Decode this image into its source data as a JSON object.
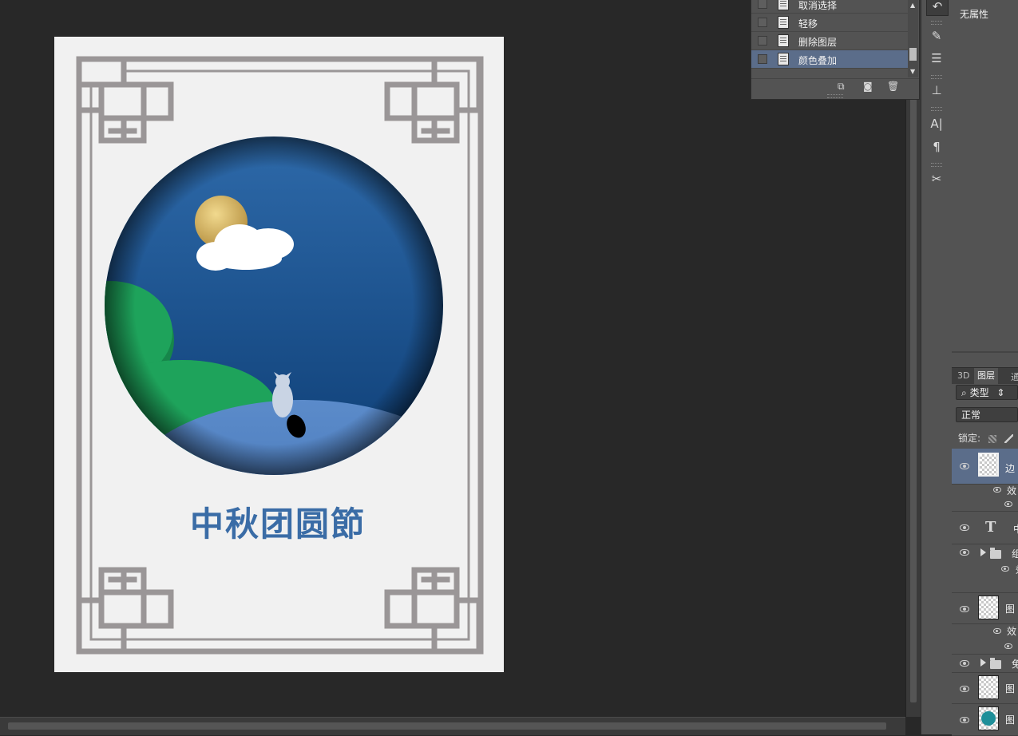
{
  "history": {
    "items": [
      {
        "label": "取消选择",
        "active": false
      },
      {
        "label": "轻移",
        "active": false
      },
      {
        "label": "删除图层",
        "active": false
      },
      {
        "label": "颜色叠加",
        "active": true
      }
    ],
    "footer_icons": [
      "new-document-from-state-icon",
      "camera-snapshot-icon",
      "trash-icon"
    ]
  },
  "artwork": {
    "title_text": "中秋团圆節",
    "colors": {
      "paper": "#f1f1f1",
      "frame": "#9a9697",
      "sky_top": "#2e6aaa",
      "sky_bottom": "#0d3d74",
      "moon": "#c9a85a",
      "hill_green": "#1ea35b",
      "ground_blue": "#4b7bbd",
      "title": "#3a6ca6"
    }
  },
  "toolbar": {
    "icons": [
      "history-brush-icon",
      "brush-presets-icon",
      "adjustments-icon",
      "clone-source-icon",
      "character-icon",
      "paragraph-icon",
      "tool-presets-icon"
    ]
  },
  "properties": {
    "label": "无属性"
  },
  "layers": {
    "tabs": [
      "3D",
      "图层",
      "通"
    ],
    "filter_kind": "类型",
    "blend_mode": "正常",
    "lock_label": "锁定:",
    "rows": [
      {
        "name": "边",
        "type": "smart",
        "selected": true
      },
      {
        "name": "效",
        "type": "effects"
      },
      {
        "name": "中",
        "type": "text"
      },
      {
        "name": "组",
        "type": "group"
      },
      {
        "name": "效",
        "type": "effects"
      },
      {
        "name": "图",
        "type": "layer"
      },
      {
        "name": "效",
        "type": "effects"
      },
      {
        "name": "兔",
        "type": "group"
      },
      {
        "name": "图",
        "type": "layer"
      },
      {
        "name": "图",
        "type": "layer-teal"
      }
    ]
  }
}
